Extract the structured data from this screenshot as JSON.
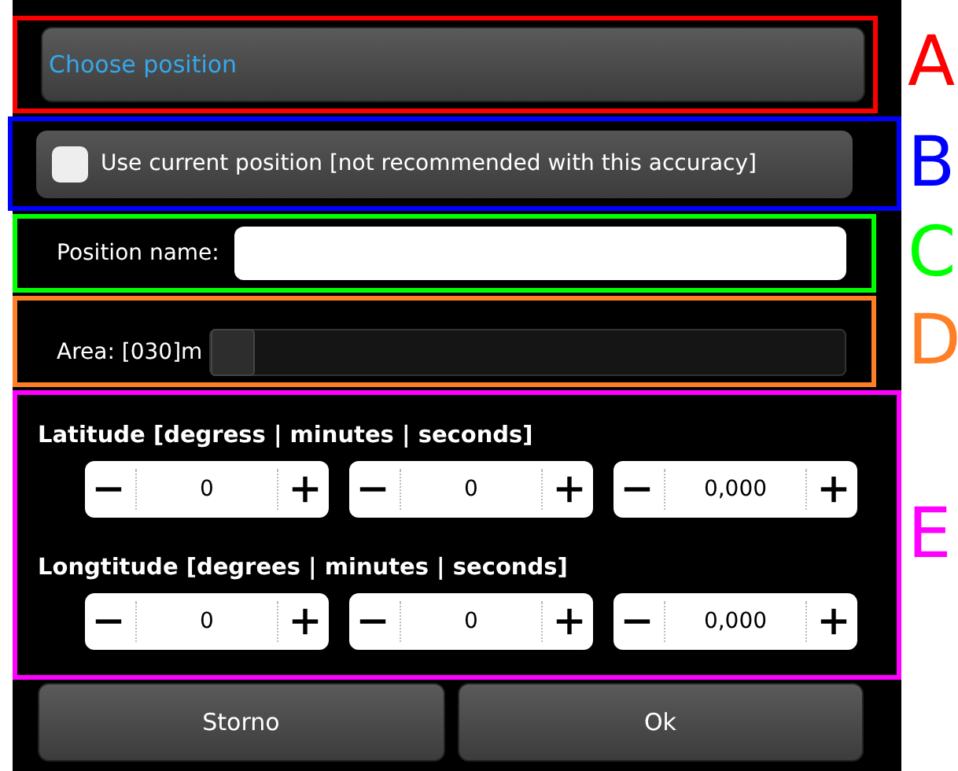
{
  "choose_button": {
    "label": "Choose position"
  },
  "current_position": {
    "label": "Use current position [not recommended with this accuracy]",
    "checked": false
  },
  "position_name": {
    "label": "Position name:"
  },
  "area": {
    "label": "Area: [030]m",
    "level": 0
  },
  "coordinates": [
    {
      "title": "Latitude [degress | minutes | seconds]",
      "fields": [
        "0",
        "0",
        "0,000"
      ]
    },
    {
      "title": "Longtitude [degrees | minutes | seconds]",
      "fields": [
        "0",
        "0",
        "0,000"
      ]
    }
  ],
  "buttons": [
    "Storno",
    "Ok"
  ],
  "annotations": [
    {
      "letter": "A",
      "color": "#ff0000"
    },
    {
      "letter": "B",
      "color": "#0000ff"
    },
    {
      "letter": "C",
      "color": "#00ff00"
    },
    {
      "letter": "D",
      "color": "#ff7f27"
    },
    {
      "letter": "E",
      "color": "#ff00ff"
    }
  ]
}
